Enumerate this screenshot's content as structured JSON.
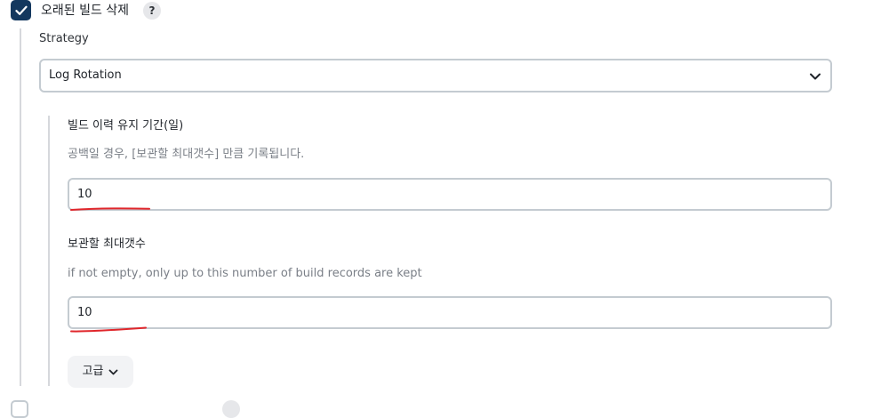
{
  "discard_builds": {
    "label": "오래된 빌드 삭제",
    "checked": true,
    "help": "?"
  },
  "strategy": {
    "label": "Strategy",
    "selected": "Log Rotation"
  },
  "days_to_keep": {
    "label": "빌드 이력 유지 기간(일)",
    "description": "공백일 경우, [보관할 최대갯수] 만큼 기록됩니다.",
    "value": "10"
  },
  "num_to_keep": {
    "label": "보관할 최대갯수",
    "description": "if not empty, only up to this number of build records are kept",
    "value": "10"
  },
  "advanced": {
    "label": "고급"
  },
  "colors": {
    "checkbox": "#14385e",
    "annotation": "#e0262b",
    "border": "#c4cbd1"
  }
}
